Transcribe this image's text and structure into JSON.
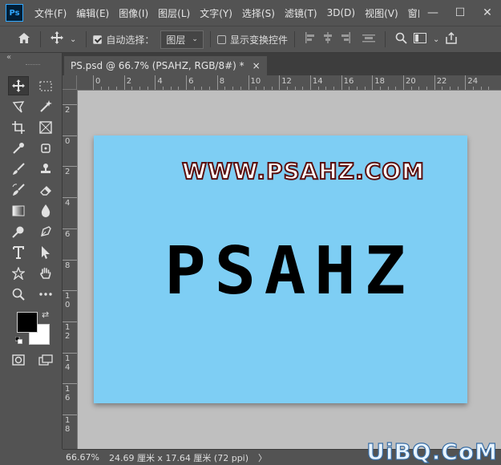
{
  "app": {
    "logo": "Ps"
  },
  "menu": [
    "文件(F)",
    "编辑(E)",
    "图像(I)",
    "图层(L)",
    "文字(Y)",
    "选择(S)",
    "滤镜(T)",
    "3D(D)",
    "视图(V)",
    "窗口(W"
  ],
  "window_controls": {
    "minimize": "—",
    "maximize": "☐",
    "close": "✕"
  },
  "options": {
    "home_icon": "home-icon",
    "move_icon": "move-tool-icon",
    "auto_select_label": "自动选择：",
    "auto_select_checked": true,
    "layer_select_value": "图层",
    "show_transform_label": "显示变换控件",
    "show_transform_checked": false
  },
  "document": {
    "tab_title": "PS.psd @ 66.7% (PSAHZ, RGB/8#) *",
    "close": "×"
  },
  "ruler": {
    "top_labels": [
      "0",
      "2",
      "4",
      "6",
      "8",
      "10",
      "12",
      "14",
      "16",
      "18",
      "20",
      "22",
      "24"
    ],
    "left_labels": [
      "2",
      "0",
      "2",
      "4",
      "6",
      "8",
      "1\n0",
      "1\n2",
      "1\n4",
      "1\n6",
      "1\n8"
    ]
  },
  "canvas": {
    "background": "#7ecef4",
    "url_text": "WWW.PSAHZ.COM",
    "main_text": "PSAHZ"
  },
  "status": {
    "zoom": "66.67%",
    "doc_size": "24.69 厘米 x 17.64 厘米 (72 ppi)",
    "arrow": "〉"
  },
  "watermark": "UiBQ.CoM"
}
